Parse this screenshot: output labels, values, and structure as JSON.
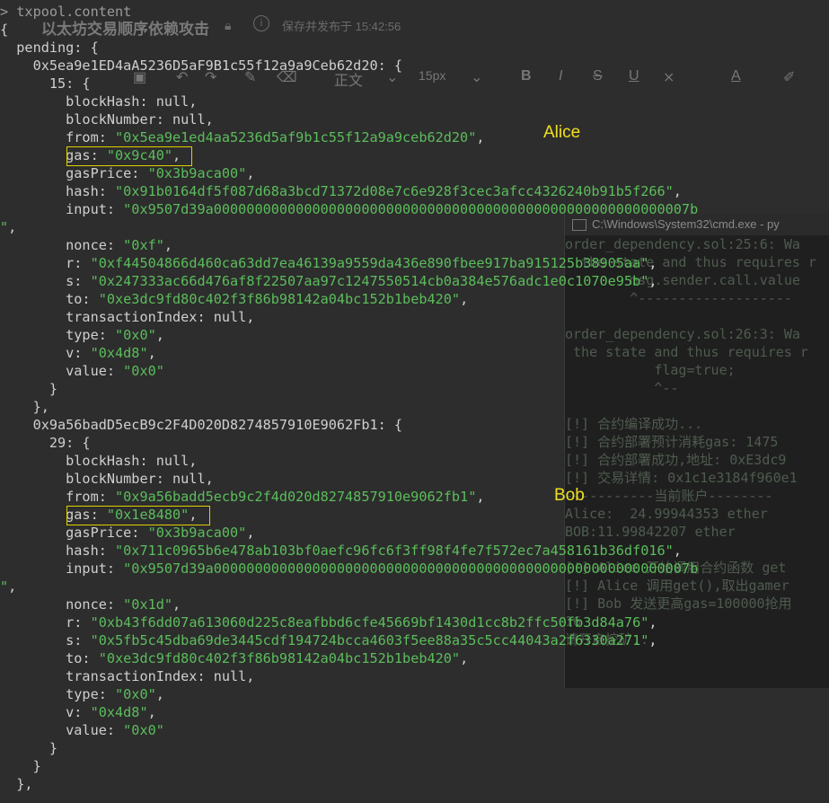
{
  "editor": {
    "title": "以太坊交易顺序依赖攻击",
    "saved_text": "保存并发布于 15:42:56",
    "font_size": "15px",
    "heading": "正文"
  },
  "cmd": {
    "title": "C:\\Windows\\System32\\cmd.exe - py",
    "lines": [
      "order_dependency.sol:25:6: Wa",
      "  the state and thus requires r",
      "        msg.sender.call.value",
      "        ^-------------------",
      "",
      "order_dependency.sol:26:3: Wa",
      " the state and thus requires r",
      "           flag=true;",
      "           ^--",
      "",
      "[!] 合约编译成功...",
      "[!] 合约部署预计消耗gas: 1475",
      "[!] 合约部署成功,地址: 0xE3dc9",
      "[!] 交易详情: 0x1c1e3184f960e1",
      "-----------当前账户--------",
      "Alice:  24.99944353 ether",
      "BOB:11.99842207 ether",
      "",
      "[!] Alice 开始调用合约函数 get",
      "[!] Alice 调用get(),取出gamer",
      "[!] Bob 发送更高gas=100000抢用",
      "16",
      "请开启挖矿..."
    ]
  },
  "console": {
    "prompt": "> txpool.content",
    "lines": [
      {
        "t": "{",
        "parts": [
          {
            "c": "k",
            "v": "{"
          }
        ]
      },
      {
        "parts": [
          {
            "c": "k",
            "v": "  pending: {"
          }
        ]
      },
      {
        "parts": [
          {
            "c": "k",
            "v": "    0x5ea9e1ED4aA5236D5aF9B1c55f12a9a9Ceb62d20: {"
          }
        ]
      },
      {
        "parts": [
          {
            "c": "k",
            "v": "      15: {"
          }
        ]
      },
      {
        "parts": [
          {
            "c": "k",
            "v": "        blockHash: null,"
          }
        ]
      },
      {
        "parts": [
          {
            "c": "k",
            "v": "        blockNumber: null,"
          }
        ]
      },
      {
        "parts": [
          {
            "c": "k",
            "v": "        from: "
          },
          {
            "c": "s",
            "v": "\"0x5ea9e1ed4aa5236d5af9b1c55f12a9a9ceb62d20\""
          },
          {
            "c": "k",
            "v": ","
          }
        ]
      },
      {
        "parts": [
          {
            "c": "k",
            "v": "        gas: "
          },
          {
            "c": "s",
            "v": "\"0x9c40\""
          },
          {
            "c": "k",
            "v": ","
          }
        ]
      },
      {
        "parts": [
          {
            "c": "k",
            "v": "        gasPrice: "
          },
          {
            "c": "s",
            "v": "\"0x3b9aca00\""
          },
          {
            "c": "k",
            "v": ","
          }
        ]
      },
      {
        "parts": [
          {
            "c": "k",
            "v": "        hash: "
          },
          {
            "c": "s",
            "v": "\"0x91b0164df5f087d68a3bcd71372d08e7c6e928f3cec3afcc4326240b91b5f266\""
          },
          {
            "c": "k",
            "v": ","
          }
        ]
      },
      {
        "parts": [
          {
            "c": "k",
            "v": "        input: "
          },
          {
            "c": "s",
            "v": "\"0x9507d39a0000000000000000000000000000000000000000000000000000000007b"
          }
        ]
      },
      {
        "parts": [
          {
            "c": "s",
            "v": "\""
          },
          {
            "c": "k",
            "v": ","
          }
        ]
      },
      {
        "parts": [
          {
            "c": "k",
            "v": "        nonce: "
          },
          {
            "c": "s",
            "v": "\"0xf\""
          },
          {
            "c": "k",
            "v": ","
          }
        ]
      },
      {
        "parts": [
          {
            "c": "k",
            "v": "        r: "
          },
          {
            "c": "s",
            "v": "\"0xf44504866d460ca63dd7ea46139a9559da436e890fbee917ba915125b38905aa\""
          },
          {
            "c": "k",
            "v": ","
          }
        ]
      },
      {
        "parts": [
          {
            "c": "k",
            "v": "        s: "
          },
          {
            "c": "s",
            "v": "\"0x247333ac66d476af8f22507aa97c1247550514cb0a384e576adc1e0c1070e95b\""
          },
          {
            "c": "k",
            "v": ","
          }
        ]
      },
      {
        "parts": [
          {
            "c": "k",
            "v": "        to: "
          },
          {
            "c": "s",
            "v": "\"0xe3dc9fd80c402f3f86b98142a04bc152b1beb420\""
          },
          {
            "c": "k",
            "v": ","
          }
        ]
      },
      {
        "parts": [
          {
            "c": "k",
            "v": "        transactionIndex: null,"
          }
        ]
      },
      {
        "parts": [
          {
            "c": "k",
            "v": "        type: "
          },
          {
            "c": "s",
            "v": "\"0x0\""
          },
          {
            "c": "k",
            "v": ","
          }
        ]
      },
      {
        "parts": [
          {
            "c": "k",
            "v": "        v: "
          },
          {
            "c": "s",
            "v": "\"0x4d8\""
          },
          {
            "c": "k",
            "v": ","
          }
        ]
      },
      {
        "parts": [
          {
            "c": "k",
            "v": "        value: "
          },
          {
            "c": "s",
            "v": "\"0x0\""
          }
        ]
      },
      {
        "parts": [
          {
            "c": "k",
            "v": "      }"
          }
        ]
      },
      {
        "parts": [
          {
            "c": "k",
            "v": "    },"
          }
        ]
      },
      {
        "parts": [
          {
            "c": "k",
            "v": "    0x9a56badD5ecB9c2F4D020D8274857910E9062Fb1: {"
          }
        ]
      },
      {
        "parts": [
          {
            "c": "k",
            "v": "      29: {"
          }
        ]
      },
      {
        "parts": [
          {
            "c": "k",
            "v": "        blockHash: null,"
          }
        ]
      },
      {
        "parts": [
          {
            "c": "k",
            "v": "        blockNumber: null,"
          }
        ]
      },
      {
        "parts": [
          {
            "c": "k",
            "v": "        from: "
          },
          {
            "c": "s",
            "v": "\"0x9a56badd5ecb9c2f4d020d8274857910e9062fb1\""
          },
          {
            "c": "k",
            "v": ","
          }
        ]
      },
      {
        "parts": [
          {
            "c": "k",
            "v": "        gas: "
          },
          {
            "c": "s",
            "v": "\"0x1e8480\""
          },
          {
            "c": "k",
            "v": ","
          }
        ]
      },
      {
        "parts": [
          {
            "c": "k",
            "v": "        gasPrice: "
          },
          {
            "c": "s",
            "v": "\"0x3b9aca00\""
          },
          {
            "c": "k",
            "v": ","
          }
        ]
      },
      {
        "parts": [
          {
            "c": "k",
            "v": "        hash: "
          },
          {
            "c": "s",
            "v": "\"0x711c0965b6e478ab103bf0aefc96fc6f3ff98f4fe7f572ec7a458161b36df016\""
          },
          {
            "c": "k",
            "v": ","
          }
        ]
      },
      {
        "parts": [
          {
            "c": "k",
            "v": "        input: "
          },
          {
            "c": "s",
            "v": "\"0x9507d39a0000000000000000000000000000000000000000000000000000000007b"
          }
        ]
      },
      {
        "parts": [
          {
            "c": "s",
            "v": "\""
          },
          {
            "c": "k",
            "v": ","
          }
        ]
      },
      {
        "parts": [
          {
            "c": "k",
            "v": "        nonce: "
          },
          {
            "c": "s",
            "v": "\"0x1d\""
          },
          {
            "c": "k",
            "v": ","
          }
        ]
      },
      {
        "parts": [
          {
            "c": "k",
            "v": "        r: "
          },
          {
            "c": "s",
            "v": "\"0xb43f6dd07a613060d225c8eafbbd6cfe45669bf1430d1cc8b2ffc50fb3d84a76\""
          },
          {
            "c": "k",
            "v": ","
          }
        ]
      },
      {
        "parts": [
          {
            "c": "k",
            "v": "        s: "
          },
          {
            "c": "s",
            "v": "\"0x5fb5c45dba69de3445cdf194724bcca4603f5ee88a35c5cc44043a2f6330a271\""
          },
          {
            "c": "k",
            "v": ","
          }
        ]
      },
      {
        "parts": [
          {
            "c": "k",
            "v": "        to: "
          },
          {
            "c": "s",
            "v": "\"0xe3dc9fd80c402f3f86b98142a04bc152b1beb420\""
          },
          {
            "c": "k",
            "v": ","
          }
        ]
      },
      {
        "parts": [
          {
            "c": "k",
            "v": "        transactionIndex: null,"
          }
        ]
      },
      {
        "parts": [
          {
            "c": "k",
            "v": "        type: "
          },
          {
            "c": "s",
            "v": "\"0x0\""
          },
          {
            "c": "k",
            "v": ","
          }
        ]
      },
      {
        "parts": [
          {
            "c": "k",
            "v": "        v: "
          },
          {
            "c": "s",
            "v": "\"0x4d8\""
          },
          {
            "c": "k",
            "v": ","
          }
        ]
      },
      {
        "parts": [
          {
            "c": "k",
            "v": "        value: "
          },
          {
            "c": "s",
            "v": "\"0x0\""
          }
        ]
      },
      {
        "parts": [
          {
            "c": "k",
            "v": "      }"
          }
        ]
      },
      {
        "parts": [
          {
            "c": "k",
            "v": "    }"
          }
        ]
      },
      {
        "parts": [
          {
            "c": "k",
            "v": "  },"
          }
        ]
      }
    ]
  },
  "annotations": {
    "alice": "Alice",
    "bob": "Bob"
  },
  "colors": {
    "background": "#2d2d2d",
    "string": "#5bbd5b",
    "highlight": "#e0d000"
  }
}
